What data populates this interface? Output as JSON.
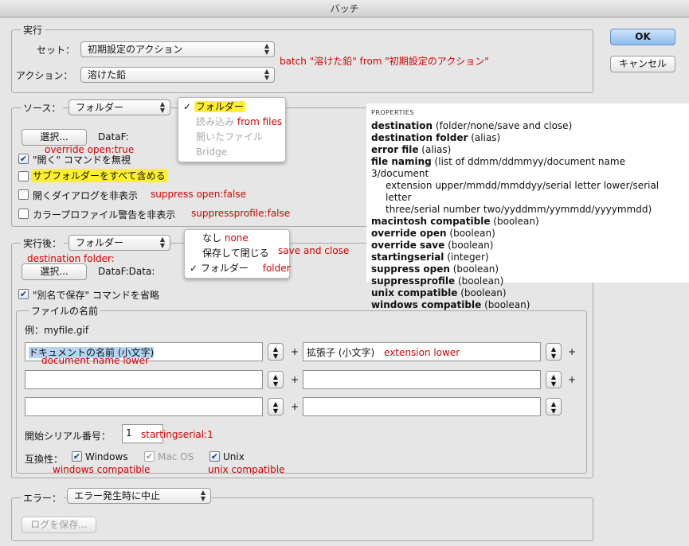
{
  "window": {
    "title": "バッチ"
  },
  "buttons": {
    "ok": "OK",
    "cancel": "キャンセル"
  },
  "play": {
    "legend": "実行",
    "set_label": "セット：",
    "set_value": "初期設定のアクション",
    "action_label": "アクション：",
    "action_value": "溶けた鉛",
    "note": "batch \"溶けた鉛\" from \"初期設定のアクション\""
  },
  "source": {
    "label": "ソース：",
    "value": "フォルダー",
    "choose_button": "選択...",
    "path": "DataF:",
    "options": [
      {
        "label": "\"開く\" コマンドを無視",
        "checked": true,
        "note": "override open:true"
      },
      {
        "label": "サブフォルダーをすべて含める",
        "checked": false,
        "note": ""
      },
      {
        "label": "開くダイアログを非表示",
        "checked": false,
        "note": "suppress open:false"
      },
      {
        "label": "カラープロファイル警告を非表示",
        "checked": false,
        "note": "suppressprofile:false"
      }
    ],
    "menu": [
      {
        "label": "フォルダー",
        "checked": true,
        "disabled": false,
        "note": ""
      },
      {
        "label": "読み込み",
        "checked": false,
        "disabled": true,
        "note": "from files"
      },
      {
        "label": "開いたファイル",
        "checked": false,
        "disabled": true,
        "note": ""
      },
      {
        "label": "Bridge",
        "checked": false,
        "disabled": true,
        "note": ""
      }
    ]
  },
  "destination": {
    "label": "実行後：",
    "value": "フォルダー",
    "note": "destination folder:",
    "choose_button": "選択...",
    "path": "DataF:Data:",
    "override_save": "\"別名で保存\" コマンドを省略",
    "override_save_checked": true,
    "menu": [
      {
        "label": "なし",
        "checked": false,
        "note": "none"
      },
      {
        "label": "保存して閉じる",
        "checked": false,
        "note": "save and close"
      },
      {
        "label": "フォルダー",
        "checked": true,
        "note": "folder"
      }
    ]
  },
  "file_naming": {
    "legend": "ファイルの名前",
    "example": "例：myfile.gif",
    "fields": [
      {
        "value": "ドキュメントの名前 (小文字)",
        "note": "document name lower"
      },
      {
        "value": "拡張子 (小文字)",
        "note": "extension lower"
      },
      {
        "value": "",
        "note": ""
      },
      {
        "value": "",
        "note": ""
      },
      {
        "value": "",
        "note": ""
      },
      {
        "value": "",
        "note": ""
      }
    ],
    "plus": "+",
    "serial_label": "開始シリアル番号：",
    "serial_value": "1",
    "serial_note": "startingserial:1",
    "compat_label": "互換性：",
    "compat": [
      {
        "label": "Windows",
        "checked": true,
        "disabled": false,
        "note": "windows compatible"
      },
      {
        "label": "Mac OS",
        "checked": true,
        "disabled": true,
        "note": ""
      },
      {
        "label": "Unix",
        "checked": true,
        "disabled": false,
        "note": "unix compatible"
      }
    ]
  },
  "errors": {
    "label": "エラー：",
    "value": "エラー発生時に中止",
    "save_log": "ログを保存..."
  },
  "properties": {
    "heading": "PROPERTIES",
    "lines": [
      {
        "name": "destination",
        "type": "(folder/none/save and close)"
      },
      {
        "name": "destination folder",
        "type": "(alias)"
      },
      {
        "name": "error file",
        "type": "(alias)"
      },
      {
        "name": "file naming",
        "type": "(list of ddmm/ddmmyy/document name 3/document"
      },
      {
        "name": "",
        "type": "extension upper/mmdd/mmddyy/serial letter lower/serial letter"
      },
      {
        "name": "",
        "type": "three/serial number two/yyddmm/yymmdd/yyyymmdd)"
      },
      {
        "name": "macintosh compatible",
        "type": "(boolean)"
      },
      {
        "name": "override open",
        "type": "(boolean)"
      },
      {
        "name": "override save",
        "type": "(boolean)"
      },
      {
        "name": "startingserial",
        "type": "(integer)"
      },
      {
        "name": "suppress open",
        "type": "(boolean)"
      },
      {
        "name": "suppressprofile",
        "type": "(boolean)"
      },
      {
        "name": "unix compatible",
        "type": "(boolean)"
      },
      {
        "name": "windows compatible",
        "type": "(boolean)"
      }
    ]
  },
  "icons": {
    "check": "checkmark-icon",
    "popup_arrows": "updown-arrows-icon"
  }
}
